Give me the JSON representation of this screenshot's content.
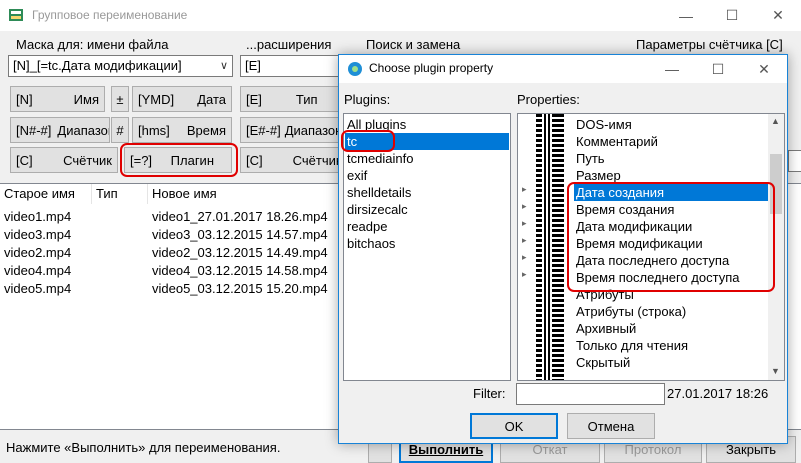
{
  "main": {
    "title": "Групповое переименование",
    "mask_label": "Маска для: имени файла",
    "ext_label": "...расширения",
    "search_label": "Поиск и замена",
    "counter_label": "Параметры счётчика [C]",
    "name_combo": "[N]_[=tc.Дата модификации]",
    "ext_combo": "[E]",
    "buttons": {
      "n_code": "[N]",
      "n_text": "Имя",
      "plus": "±",
      "ymd_code": "[YMD]",
      "ymd_text": "Дата",
      "range_code": "[N#-#]",
      "range_text": "Диапазон",
      "hash": "#",
      "hms_code": "[hms]",
      "hms_text": "Время",
      "c_code": "[C]",
      "c_text": "Счётчик",
      "plugin_code": "[=?]",
      "plugin_text": "Плагин",
      "e_code": "[E]",
      "e_text": "Тип",
      "e_range_code": "[E#-#]",
      "e_range_text": "Диапазон",
      "e_c_code": "[C]",
      "e_c_text": "Счётчик"
    },
    "columns": [
      "Старое имя",
      "Тип",
      "Новое имя"
    ],
    "rows": [
      {
        "old": "video1.mp4",
        "new": "video1_27.01.2017 18.26.mp4"
      },
      {
        "old": "video3.mp4",
        "new": "video3_03.12.2015 14.57.mp4"
      },
      {
        "old": "video2.mp4",
        "new": "video2_03.12.2015 14.49.mp4"
      },
      {
        "old": "video4.mp4",
        "new": "video4_03.12.2015 14.58.mp4"
      },
      {
        "old": "video5.mp4",
        "new": "video5_03.12.2015 15.20.mp4"
      }
    ],
    "status": "Нажмите «Выполнить» для переименования.",
    "bottom_buttons": {
      "run": "Выполнить",
      "undo": "Откат",
      "log": "Протокол",
      "close": "Закрыть"
    }
  },
  "dialog": {
    "title": "Choose plugin property",
    "plugins_label": "Plugins:",
    "properties_label": "Properties:",
    "plugins": [
      "All plugins",
      "tc",
      "tcmediainfo",
      "exif",
      "shelldetails",
      "dirsizecalc",
      "readpe",
      "bitchaos"
    ],
    "selected_plugin": "tc",
    "properties": [
      "DOS-имя",
      "Комментарий",
      "Путь",
      "Размер",
      "Дата создания",
      "Время создания",
      "Дата модификации",
      "Время модификации",
      "Дата последнего доступа",
      "Время последнего доступа",
      "Атрибуты",
      "Атрибуты (строка)",
      "Архивный",
      "Только для чтения",
      "Скрытый"
    ],
    "filter_label": "Filter:",
    "filter_value": "",
    "preview": "27.01.2017 18:26",
    "ok": "OK",
    "cancel": "Отмена"
  },
  "colors": {
    "accent": "#0078d7",
    "highlight": "#e00000"
  }
}
